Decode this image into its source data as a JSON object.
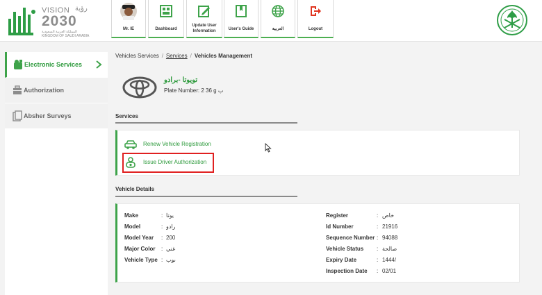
{
  "header": {
    "logo": {
      "vision_text": "VISION",
      "arabic_text": "رؤية",
      "year_text": "2030",
      "subtitle": "المملكة العربية السعودية KINGDOM OF SAUDI ARABIA"
    },
    "tiles": [
      {
        "label": "Mr. IE",
        "icon": "user-avatar-icon"
      },
      {
        "label": "Dashboard",
        "icon": "dashboard-icon"
      },
      {
        "label": "Update User Information",
        "icon": "edit-icon"
      },
      {
        "label": "User's Guide",
        "icon": "guide-book-icon"
      },
      {
        "label": "العربية",
        "icon": "globe-icon"
      },
      {
        "label": "Logout",
        "icon": "logout-icon"
      }
    ],
    "emblem": "saudi-emblem-icon"
  },
  "sidebar": {
    "items": [
      {
        "label": "Electronic Services",
        "icon": "electronic-services-icon",
        "active": true
      },
      {
        "label": "Authorization",
        "icon": "briefcase-icon",
        "active": false
      },
      {
        "label": "Absher Surveys",
        "icon": "survey-icon",
        "active": false
      }
    ]
  },
  "breadcrumb": {
    "root": "Vehicles Services",
    "link": "Services",
    "current": "Vehicles Management"
  },
  "vehicle": {
    "name": "تويوتا -برادو",
    "plate": "Plate Number: 2  36 g ب",
    "brand_icon": "toyota-logo-icon"
  },
  "services": {
    "title": "Services",
    "items": [
      {
        "label": "Renew Vehicle Registration",
        "icon": "car-icon"
      },
      {
        "label": "Issue Driver Authorization",
        "icon": "driver-icon"
      }
    ]
  },
  "vehicle_details": {
    "title": "Vehicle Details",
    "left": [
      {
        "label": "Make",
        "value": "يوتا"
      },
      {
        "label": "Model",
        "value": "رادو"
      },
      {
        "label": "Model Year",
        "value": "200"
      },
      {
        "label": "Major Color",
        "value": "غني"
      },
      {
        "label": "Vehicle Type",
        "value": "ىوب"
      }
    ],
    "right": [
      {
        "label": "Register",
        "value": "خاص"
      },
      {
        "label": "Id Number",
        "value": "21916"
      },
      {
        "label": "Sequence Number",
        "value": "94088"
      },
      {
        "label": "Vehicle Status",
        "value": "صالحة"
      },
      {
        "label": "Expiry Date",
        "value": "1444/"
      },
      {
        "label": "Inspection Date",
        "value": "02/01"
      }
    ],
    "colon": ":"
  },
  "colors": {
    "accent_green": "#3ea34a",
    "text_green": "#2d9a3c",
    "highlight_red": "#e02020"
  }
}
